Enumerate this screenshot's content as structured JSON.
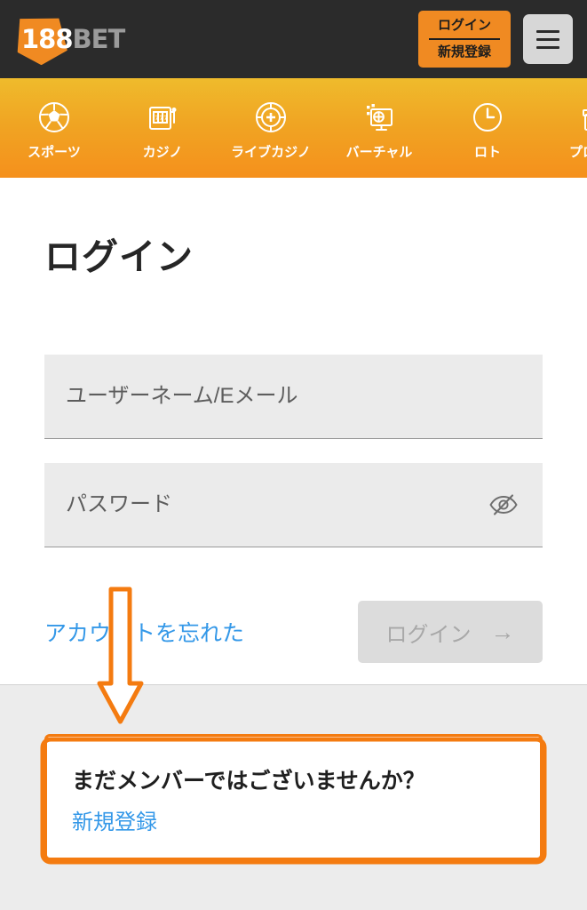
{
  "header": {
    "logo": {
      "primary": "188",
      "secondary": "BET",
      "icon": "188bet-logo-icon"
    },
    "login_register_button": {
      "login_label": "ログイン",
      "register_label": "新規登録"
    },
    "menu_button": {
      "icon": "hamburger-menu-icon"
    },
    "background_color": "#2b2b2b",
    "accent_color": "#F08A22"
  },
  "nav": {
    "items": [
      {
        "label": "スポーツ",
        "icon": "soccer-ball-icon"
      },
      {
        "label": "カジノ",
        "icon": "slot-machine-icon"
      },
      {
        "label": "ライブカジノ",
        "icon": "casino-chip-icon"
      },
      {
        "label": "バーチャル",
        "icon": "virtual-monitor-icon"
      },
      {
        "label": "ロト",
        "icon": "lotto-clock-icon"
      },
      {
        "label": "プロモー",
        "icon": "gift-box-icon"
      }
    ],
    "gradient_top": "#EFBB2C",
    "gradient_bottom": "#F5901C"
  },
  "main": {
    "page_title": "ログイン",
    "username_field": {
      "placeholder": "ユーザーネーム/Eメール",
      "value": ""
    },
    "password_field": {
      "placeholder": "パスワード",
      "value": "",
      "toggle_icon": "eye-slash-icon"
    },
    "forgot_link": "アカウントを忘れた",
    "submit_button": {
      "label": "ログイン",
      "arrow": "→",
      "state": "disabled"
    }
  },
  "bottom": {
    "callout_title": "まだメンバーではございませんか？",
    "callout_link": "新規登録",
    "highlight_color": "#F47B10"
  },
  "annotations": {
    "arrow": {
      "direction": "down",
      "color": "#F47B10"
    },
    "highlight_box": {
      "shape": "rectangle",
      "color": "#F47B10"
    }
  }
}
